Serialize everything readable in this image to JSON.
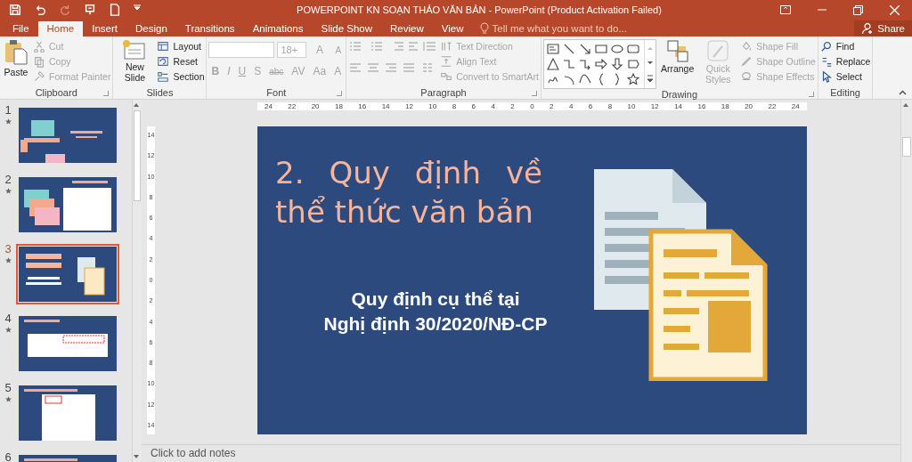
{
  "title_bar": {
    "title": "POWERPOINT KN SOẠN THẢO VĂN BẢN - PowerPoint (Product Activation Failed)",
    "quick_access": [
      {
        "kind": "save",
        "disabled": false
      },
      {
        "kind": "undo",
        "disabled": false
      },
      {
        "kind": "redo",
        "disabled": true
      },
      {
        "kind": "present",
        "disabled": false
      },
      {
        "kind": "new",
        "disabled": false
      }
    ]
  },
  "tabs": [
    {
      "label": "File",
      "selected": false
    },
    {
      "label": "Home",
      "selected": true
    },
    {
      "label": "Insert",
      "selected": false
    },
    {
      "label": "Design",
      "selected": false
    },
    {
      "label": "Transitions",
      "selected": false
    },
    {
      "label": "Animations",
      "selected": false
    },
    {
      "label": "Slide Show",
      "selected": false
    },
    {
      "label": "Review",
      "selected": false
    },
    {
      "label": "View",
      "selected": false
    }
  ],
  "tell_me": {
    "placeholder": "Tell me what you want to do..."
  },
  "share": {
    "label": "Share"
  },
  "ribbon": {
    "clipboard": {
      "label": "Clipboard",
      "paste": {
        "label": "Paste",
        "disabled": false
      },
      "items": [
        {
          "label": "Cut",
          "kind": "cut",
          "disabled": true
        },
        {
          "label": "Copy",
          "kind": "copy",
          "disabled": true
        },
        {
          "label": "Format Painter",
          "kind": "brush",
          "disabled": true
        }
      ]
    },
    "slides": {
      "label": "Slides",
      "new_slide": {
        "label": "New Slide",
        "disabled": false
      },
      "items": [
        {
          "label": "Layout",
          "kind": "layout",
          "disabled": false
        },
        {
          "label": "Reset",
          "kind": "reset",
          "disabled": false
        },
        {
          "label": "Section",
          "kind": "section",
          "disabled": false
        }
      ]
    },
    "font": {
      "label": "Font",
      "font_size": {
        "value": "18+",
        "disabled": true
      },
      "size_buttons": [
        {
          "label": "A",
          "kind": "grow",
          "disabled": true
        },
        {
          "label": "A",
          "kind": "shrink",
          "disabled": true
        }
      ],
      "formats": [
        {
          "label": "B",
          "kind": "bold",
          "disabled": true
        },
        {
          "label": "I",
          "kind": "italic",
          "disabled": true
        },
        {
          "label": "U",
          "kind": "underline",
          "disabled": true
        },
        {
          "label": "S",
          "kind": "shadow",
          "disabled": true
        },
        {
          "label": "abc",
          "kind": "strike",
          "disabled": true
        },
        {
          "label": "AV",
          "kind": "spacing",
          "disabled": true
        },
        {
          "label": "Aa",
          "kind": "case",
          "disabled": true
        },
        {
          "label": "A",
          "kind": "color",
          "disabled": true
        }
      ]
    },
    "paragraph": {
      "label": "Paragraph",
      "items": [
        {
          "label": "Text Direction",
          "kind": "direction",
          "disabled": true
        },
        {
          "label": "Align Text",
          "kind": "align",
          "disabled": true
        },
        {
          "label": "Convert to SmartArt",
          "kind": "smartart",
          "disabled": true
        }
      ]
    },
    "drawing": {
      "label": "Drawing",
      "arrange": {
        "label": "Arrange",
        "disabled": false
      },
      "quick_styles": {
        "label": "Quick Styles",
        "disabled": true
      },
      "items": [
        {
          "label": "Shape Fill",
          "kind": "fill",
          "disabled": true
        },
        {
          "label": "Shape Outline",
          "kind": "outline",
          "disabled": true
        },
        {
          "label": "Shape Effects",
          "kind": "effects",
          "disabled": true
        }
      ]
    },
    "editing": {
      "label": "Editing",
      "items": [
        {
          "label": "Find",
          "kind": "find",
          "disabled": false
        },
        {
          "label": "Replace",
          "kind": "replace",
          "disabled": false
        },
        {
          "label": "Select",
          "kind": "select",
          "disabled": false
        }
      ]
    }
  },
  "thumbnails": [
    {
      "number": "1",
      "selected": false,
      "animated": true,
      "kind": "illustration"
    },
    {
      "number": "2",
      "selected": false,
      "animated": true,
      "kind": "screens"
    },
    {
      "number": "3",
      "selected": true,
      "animated": true,
      "kind": "documents"
    },
    {
      "number": "4",
      "selected": false,
      "animated": true,
      "kind": "banner"
    },
    {
      "number": "5",
      "selected": false,
      "animated": true,
      "kind": "page"
    },
    {
      "number": "6",
      "selected": false,
      "animated": false,
      "kind": "page"
    }
  ],
  "rulers": {
    "horizontal": [
      "24",
      "22",
      "20",
      "18",
      "16",
      "14",
      "12",
      "10",
      "8",
      "6",
      "4",
      "2",
      "0",
      "2",
      "4",
      "6",
      "8",
      "10",
      "12",
      "14",
      "16",
      "18",
      "20",
      "22",
      "24"
    ],
    "vertical": [
      "14",
      "12",
      "10",
      "8",
      "6",
      "4",
      "2",
      "0",
      "2",
      "4",
      "6",
      "8",
      "10",
      "12",
      "14"
    ]
  },
  "slide": {
    "title": [
      "2. Quy định về",
      "thể thức văn bản"
    ],
    "subtitle": [
      "Quy định cụ thể tại",
      "Nghị định 30/2020/NĐ-CP"
    ]
  },
  "notes": {
    "placeholder": "Click to add notes"
  }
}
